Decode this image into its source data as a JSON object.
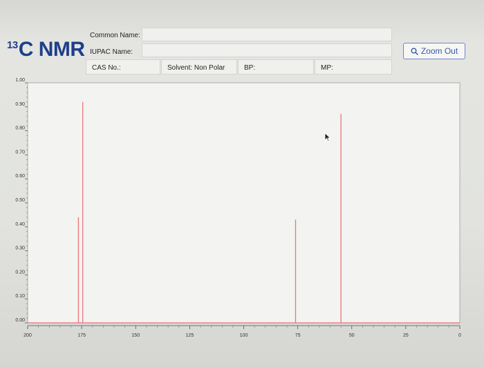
{
  "header": {
    "title_sup": "13",
    "title": "C NMR",
    "common_name_label": "Common Name:",
    "iupac_name_label": "IUPAC Name:",
    "cas_label": "CAS No.:",
    "solvent": "Solvent: Non Polar",
    "bp_label": "BP:",
    "mp_label": "MP:"
  },
  "zoom_out": {
    "label": "Zoom Out",
    "icon": "search-icon"
  },
  "colors": {
    "peak": "#e8737b",
    "accent": "#3659a8"
  },
  "chart_data": {
    "type": "bar",
    "title": "",
    "xlabel": "",
    "ylabel": "",
    "xlim": [
      200,
      0
    ],
    "ylim": [
      0,
      1.0
    ],
    "x_ticks": [
      "200",
      "175",
      "150",
      "125",
      "100",
      "75",
      "50",
      "25",
      "0"
    ],
    "x_tick_values": [
      200,
      175,
      150,
      125,
      100,
      75,
      50,
      25,
      0
    ],
    "y_ticks": [
      "0.00",
      "0.10",
      "0.20",
      "0.30",
      "0.40",
      "0.50",
      "0.60",
      "0.70",
      "0.80",
      "0.90",
      "1.00"
    ],
    "y_tick_values": [
      0,
      0.1,
      0.2,
      0.3,
      0.4,
      0.5,
      0.6,
      0.7,
      0.8,
      0.9,
      1.0
    ],
    "grid": false,
    "peaks": [
      {
        "ppm": 176.5,
        "intensity": 0.44
      },
      {
        "ppm": 174.5,
        "intensity": 0.92
      },
      {
        "ppm": 76,
        "intensity": 0.43
      },
      {
        "ppm": 55,
        "intensity": 0.87
      }
    ]
  }
}
